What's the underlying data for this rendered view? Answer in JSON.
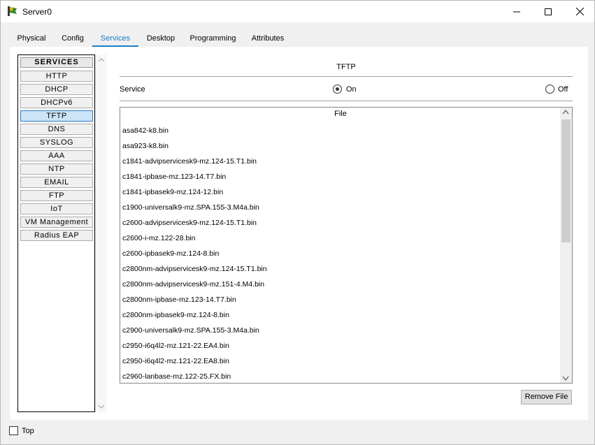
{
  "window": {
    "title": "Server0"
  },
  "tabs": [
    {
      "label": "Physical"
    },
    {
      "label": "Config"
    },
    {
      "label": "Services"
    },
    {
      "label": "Desktop"
    },
    {
      "label": "Programming"
    },
    {
      "label": "Attributes"
    }
  ],
  "active_tab": "Services",
  "services": {
    "header": "SERVICES",
    "items": [
      {
        "label": "HTTP"
      },
      {
        "label": "DHCP"
      },
      {
        "label": "DHCPv6"
      },
      {
        "label": "TFTP"
      },
      {
        "label": "DNS"
      },
      {
        "label": "SYSLOG"
      },
      {
        "label": "AAA"
      },
      {
        "label": "NTP"
      },
      {
        "label": "EMAIL"
      },
      {
        "label": "FTP"
      },
      {
        "label": "IoT"
      },
      {
        "label": "VM Management"
      },
      {
        "label": "Radius EAP"
      }
    ],
    "selected": "TFTP"
  },
  "tftp": {
    "title": "TFTP",
    "service_label": "Service",
    "on_label": "On",
    "off_label": "Off",
    "service_state": "On",
    "file_header": "File",
    "files": [
      "asa842-k8.bin",
      "asa923-k8.bin",
      "c1841-advipservicesk9-mz.124-15.T1.bin",
      "c1841-ipbase-mz.123-14.T7.bin",
      "c1841-ipbasek9-mz.124-12.bin",
      "c1900-universalk9-mz.SPA.155-3.M4a.bin",
      "c2600-advipservicesk9-mz.124-15.T1.bin",
      "c2600-i-mz.122-28.bin",
      "c2600-ipbasek9-mz.124-8.bin",
      "c2800nm-advipservicesk9-mz.124-15.T1.bin",
      "c2800nm-advipservicesk9-mz.151-4.M4.bin",
      "c2800nm-ipbase-mz.123-14.T7.bin",
      "c2800nm-ipbasek9-mz.124-8.bin",
      "c2900-universalk9-mz.SPA.155-3.M4a.bin",
      "c2950-i6q4l2-mz.121-22.EA4.bin",
      "c2950-i6q4l2-mz.121-22.EA8.bin",
      "c2960-lanbase-mz.122-25.FX.bin"
    ],
    "remove_button": "Remove File"
  },
  "footer": {
    "top_label": "Top",
    "top_checked": false
  },
  "colors": {
    "accent": "#1a7fc7",
    "selected_service_bg": "#cce4f7"
  }
}
